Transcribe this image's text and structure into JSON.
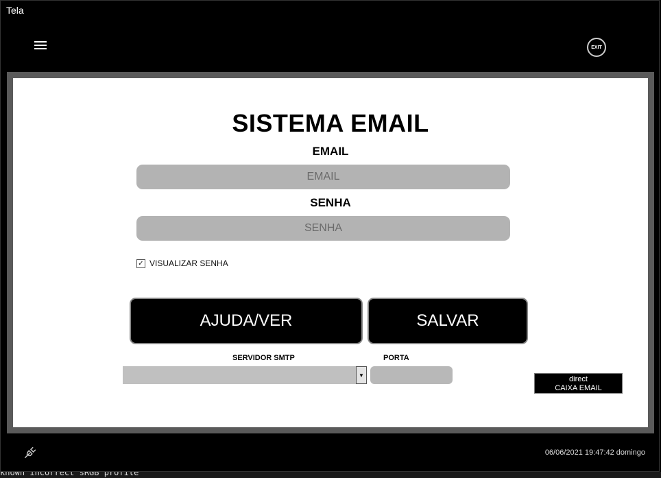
{
  "window": {
    "title": "Tela"
  },
  "underlay": {
    "bottom_text": "known incorrect sRGB profile"
  },
  "toolbar": {
    "menu_icon": "hamburger-menu-icon",
    "exit_label": "EXIT"
  },
  "main": {
    "title": "SISTEMA EMAIL",
    "email": {
      "label": "EMAIL",
      "placeholder": "EMAIL",
      "value": ""
    },
    "password": {
      "label": "SENHA",
      "placeholder": "SENHA",
      "value": ""
    },
    "show_password": {
      "label": "VISUALIZAR SENHA",
      "checked": true
    },
    "buttons": {
      "help": "AJUDA/VER",
      "save": "SALVAR"
    },
    "smtp_server": {
      "label": "SERVIDOR SMTP",
      "value": ""
    },
    "port": {
      "label": "PORTA",
      "value": ""
    },
    "info_box": {
      "line1": "direct",
      "line2": "CAIXA EMAIL"
    }
  },
  "statusbar": {
    "connection_icon": "plug-icon",
    "datetime": "06/06/2021  19:47:42 domingo"
  },
  "colors": {
    "background": "#000000",
    "frame": "#5a5a5a",
    "panel": "#ffffff",
    "field": "#b3b3b3"
  }
}
